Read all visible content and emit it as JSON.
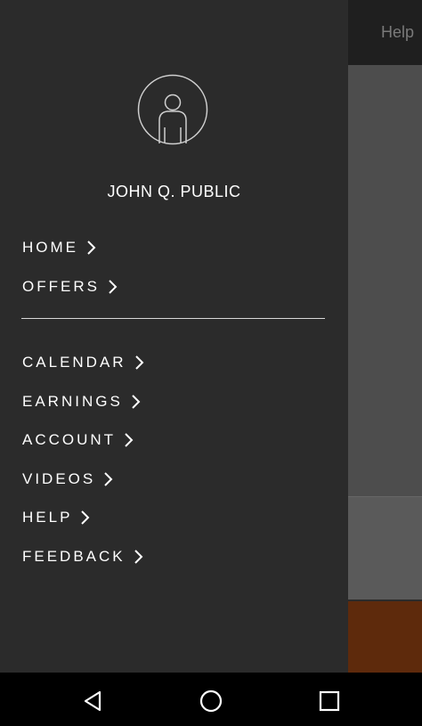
{
  "background_app": {
    "header_help": "Help",
    "accent_color": "#5e2a0c"
  },
  "drawer": {
    "user_name": "JOHN Q. PUBLIC",
    "avatar_icon": "user-avatar-icon",
    "primary_items": [
      {
        "label": "HOME"
      },
      {
        "label": "OFFERS"
      }
    ],
    "secondary_items": [
      {
        "label": "CALENDAR"
      },
      {
        "label": "EARNINGS"
      },
      {
        "label": "ACCOUNT"
      },
      {
        "label": "VIDEOS"
      },
      {
        "label": "HELP"
      },
      {
        "label": "FEEDBACK"
      }
    ]
  },
  "navbar": {
    "buttons": [
      "back-icon",
      "home-icon",
      "recents-icon"
    ]
  }
}
